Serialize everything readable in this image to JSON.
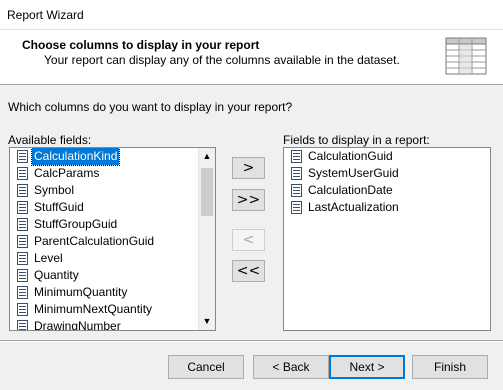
{
  "window": {
    "title": "Report Wizard"
  },
  "header": {
    "title": "Choose columns to display in your report",
    "subtitle": "Your report can display any of the columns available in the dataset.",
    "icon": "table-columns-icon"
  },
  "question": "Which columns do you want to display in your report?",
  "available": {
    "label": "Available fields:",
    "selected_item": "CalculationKind",
    "items": [
      "CalculationKind",
      "CalcParams",
      "Symbol",
      "StuffGuid",
      "StuffGroupGuid",
      "ParentCalculationGuid",
      "Level",
      "Quantity",
      "MinimumQuantity",
      "MinimumNextQuantity",
      "DrawingNumber"
    ]
  },
  "display": {
    "label": "Fields to display in a report:",
    "items": [
      "CalculationGuid",
      "SystemUserGuid",
      "CalculationDate",
      "LastActualization"
    ]
  },
  "move_buttons": {
    "add_one": ">",
    "add_all": ">>",
    "remove_one": "<",
    "remove_all": "<<",
    "remove_one_enabled": false
  },
  "footer": {
    "cancel": "Cancel",
    "back": "< Back",
    "next": "Next >",
    "finish": "Finish"
  },
  "colors": {
    "selection": "#0078d7",
    "default_button_border": "#0078d7"
  }
}
